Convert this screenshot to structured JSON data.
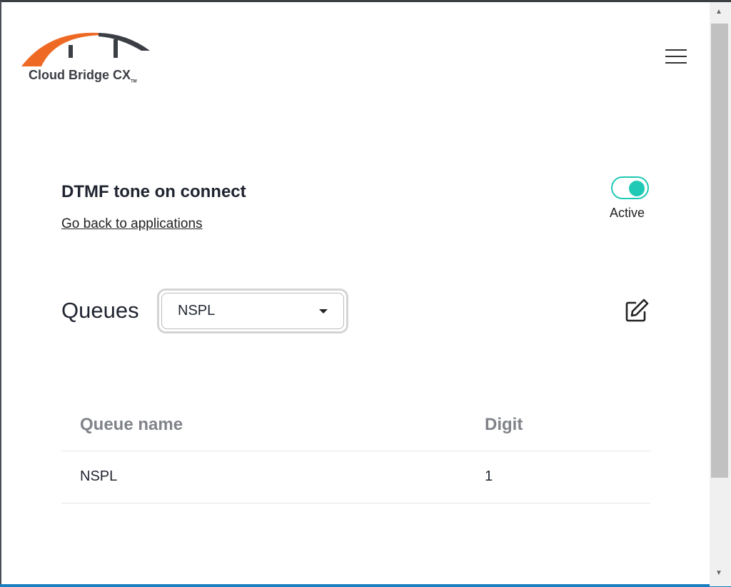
{
  "logo": {
    "text": "Cloud Bridge CX",
    "tm": "TM",
    "colors": {
      "arc": "#ee6a24",
      "dark": "#3b3e44"
    }
  },
  "header": {
    "menu_icon": "hamburger-icon"
  },
  "app": {
    "title": "DTMF tone on connect",
    "back_link": "Go back to applications",
    "status_label": "Active",
    "status_on": true,
    "accent": "#20c9b5"
  },
  "queues": {
    "label": "Queues",
    "selected": "NSPL",
    "edit_icon": "edit-icon"
  },
  "table": {
    "headers": [
      "Queue name",
      "Digit"
    ],
    "rows": [
      {
        "name": "NSPL",
        "digit": "1"
      }
    ]
  }
}
